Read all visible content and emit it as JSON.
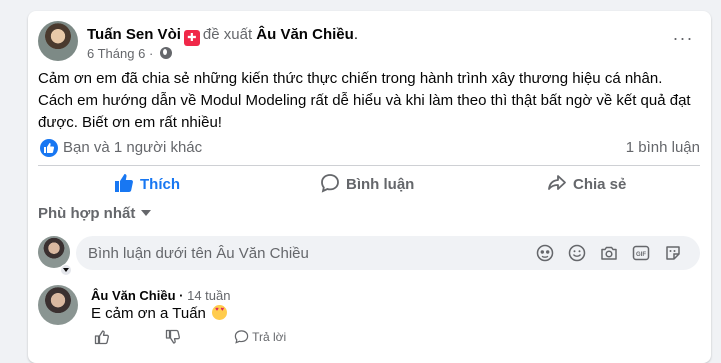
{
  "post": {
    "author": "Tuấn Sen Vòi",
    "recommend_text": "đề xuất",
    "recipient": "Âu Văn Chiều",
    "date": "6 Tháng 6",
    "separator": "·",
    "text": "Cảm ơn em đã chia sẻ những kiến thức thực chiến trong hành trình xây thương hiệu cá nhân. Cách em hướng dẫn về Modul Modeling rất dễ hiểu và khi làm theo thì thật bất ngờ về kết quả đạt được. Biết ơn em rất nhiều!",
    "more_icon": "ellipsis-icon",
    "privacy_icon": "globe-icon"
  },
  "reactions": {
    "summary": "Bạn và 1 người khác",
    "comment_count": "1 bình luận",
    "icon": "like-icon"
  },
  "actions": {
    "like_label": "Thích",
    "comment_label": "Bình luận",
    "share_label": "Chia sẻ",
    "liked": true
  },
  "comments": {
    "sort_label": "Phù hợp nhất",
    "input_placeholder": "Bình luận dưới tên Âu Văn Chiều",
    "tools": [
      "avatar-sticker-icon",
      "emoji-icon",
      "camera-icon",
      "gif-icon",
      "sticker-icon"
    ],
    "items": [
      {
        "author": "Âu Văn Chiều",
        "time": "14 tuần",
        "text": "E cảm ơn a Tuấn",
        "reply_label": "Trả lời"
      }
    ]
  },
  "colors": {
    "accent": "#1877f2",
    "secondary_text": "#65676b",
    "background": "#f0f2f5"
  }
}
